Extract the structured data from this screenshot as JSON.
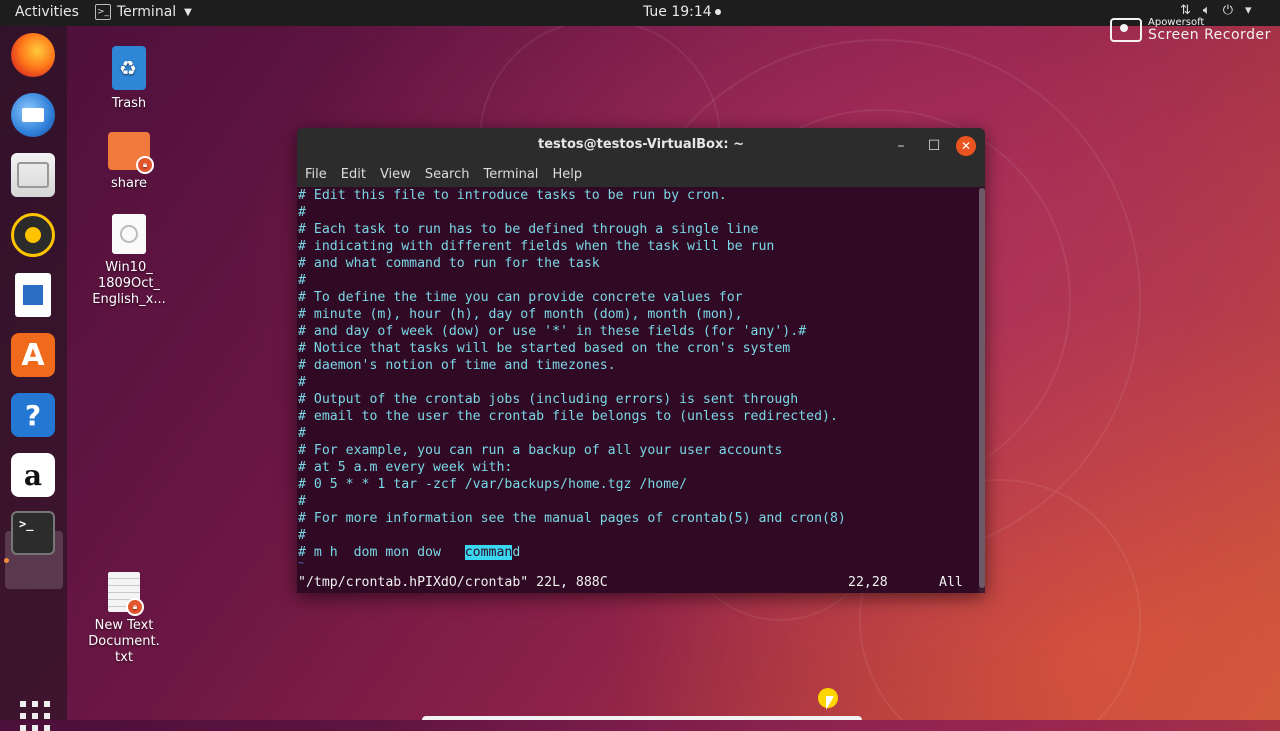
{
  "topbar": {
    "activities": "Activities",
    "app_name": "Terminal",
    "clock": "Tue 19:14"
  },
  "watermark": {
    "line1": "Apowersoft",
    "line2": "Screen Recorder"
  },
  "dock": {
    "items": [
      {
        "name": "Firefox",
        "icon": "firefox-icon"
      },
      {
        "name": "Thunderbird",
        "icon": "mail-icon"
      },
      {
        "name": "Files",
        "icon": "files-icon"
      },
      {
        "name": "Rhythmbox",
        "icon": "music-icon"
      },
      {
        "name": "LibreOffice Writer",
        "icon": "document-icon"
      },
      {
        "name": "Ubuntu Software",
        "icon": "store-icon",
        "glyph": "A"
      },
      {
        "name": "Help",
        "icon": "help-icon",
        "glyph": "?"
      },
      {
        "name": "Amazon",
        "icon": "amazon-icon",
        "glyph": "a"
      },
      {
        "name": "Terminal",
        "icon": "terminal-icon",
        "glyph": ">_"
      }
    ]
  },
  "desktop": {
    "trash": "Trash",
    "share": "share",
    "iso": [
      "Win10_",
      "1809Oct_",
      "English_x..."
    ],
    "textdoc": [
      "New Text",
      "Document.",
      "txt"
    ]
  },
  "terminal": {
    "title": "testos@testos-VirtualBox: ~",
    "menu": [
      "File",
      "Edit",
      "View",
      "Search",
      "Terminal",
      "Help"
    ],
    "lines": [
      "# Edit this file to introduce tasks to be run by cron.",
      "#",
      "# Each task to run has to be defined through a single line",
      "# indicating with different fields when the task will be run",
      "# and what command to run for the task",
      "#",
      "# To define the time you can provide concrete values for",
      "# minute (m), hour (h), day of month (dom), month (mon),",
      "# and day of week (dow) or use '*' in these fields (for 'any').#",
      "# Notice that tasks will be started based on the cron's system",
      "# daemon's notion of time and timezones.",
      "#",
      "# Output of the crontab jobs (including errors) is sent through",
      "# email to the user the crontab file belongs to (unless redirected).",
      "#",
      "# For example, you can run a backup of all your user accounts",
      "# at 5 a.m every week with:",
      "# 0 5 * * 1 tar -zcf /var/backups/home.tgz /home/",
      "#",
      "# For more information see the manual pages of crontab(5) and cron(8)",
      "#"
    ],
    "last_line_prefix": "# m h  dom mon dow   ",
    "last_line_highlight": "comman",
    "last_line_suffix": "d",
    "tilde": "~",
    "status_file": "\"/tmp/crontab.hPIXdO/crontab\" 22L, 888C",
    "status_pos": "22,28",
    "status_all": "All"
  }
}
